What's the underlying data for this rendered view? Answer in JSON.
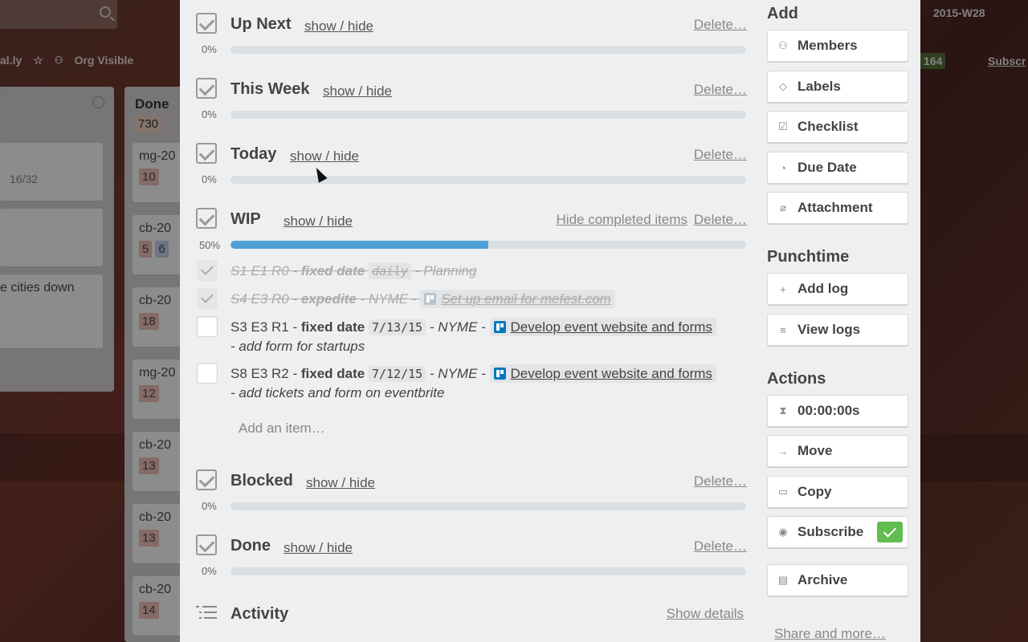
{
  "background": {
    "board_header": [
      "al.ly",
      "Org Visible"
    ],
    "done_list": {
      "title": "Done",
      "count": "730"
    },
    "left_card_badge": "16/32",
    "left_card_text": "e cities down",
    "done_cards": [
      {
        "name": "mg-20",
        "badge": "10"
      },
      {
        "name": "cb-20",
        "badge": "5",
        "badge2": "6"
      },
      {
        "name": "cb-20",
        "badge": "18"
      },
      {
        "name": "mg-20",
        "badge": "12"
      },
      {
        "name": "cb-20",
        "badge": "13"
      },
      {
        "name": "cb-20",
        "badge": "13"
      },
      {
        "name": "cb-20",
        "badge": "14"
      }
    ],
    "right_header": {
      "week": "2015-W28",
      "count": "164",
      "subscribe": "Subscr"
    }
  },
  "checklists": [
    {
      "title": "Up Next",
      "toggle": "show / hide",
      "delete": "Delete…",
      "percent": "0%",
      "progress": 0
    },
    {
      "title": "This Week",
      "toggle": "show / hide",
      "delete": "Delete…",
      "percent": "0%",
      "progress": 0
    },
    {
      "title": "Today",
      "toggle": "show / hide",
      "delete": "Delete…",
      "percent": "0%",
      "progress": 0
    },
    {
      "title": "WIP",
      "toggle": "show / hide",
      "hide_completed": "Hide completed items",
      "delete": "Delete…",
      "percent": "50%",
      "progress": 0.5
    },
    {
      "title": "Blocked",
      "toggle": "show / hide",
      "delete": "Delete…",
      "percent": "0%",
      "progress": 0
    },
    {
      "title": "Done",
      "toggle": "show / hide",
      "delete": "Delete…",
      "percent": "0%",
      "progress": 0
    }
  ],
  "wip_items": [
    {
      "done": true,
      "id": "S1 E1 R0",
      "sep1": " - ",
      "kind": "fixed date",
      "code": "daily",
      "rest": " - Planning"
    },
    {
      "done": true,
      "id": "S4 E3 R0",
      "sep1": " - ",
      "kind": "expedite",
      "rest": " - NYME - ",
      "link": "Set up email for mefest.com"
    },
    {
      "done": false,
      "id": "S3 E3 R1",
      "sep1": " - ",
      "kind": "fixed date",
      "code": "7/13/15",
      "rest": " - NYME - ",
      "link": "Develop event website and forms",
      "tail": "- add form for startups"
    },
    {
      "done": false,
      "id": "S8 E3 R2",
      "sep1": " - ",
      "kind": "fixed date",
      "code": "7/12/15",
      "rest": " - NYME - ",
      "link": "Develop event website and forms",
      "tail": "- add tickets and form on eventbrite"
    }
  ],
  "add_item": "Add an item…",
  "activity": {
    "title": "Activity",
    "show_details": "Show details"
  },
  "sidebar": {
    "add_heading": "Add",
    "add_buttons": [
      {
        "label": "Members",
        "icon": "person-icon"
      },
      {
        "label": "Labels",
        "icon": "tag-icon"
      },
      {
        "label": "Checklist",
        "icon": "checkbox-icon"
      },
      {
        "label": "Due Date",
        "icon": "clock-icon"
      },
      {
        "label": "Attachment",
        "icon": "paperclip-icon"
      }
    ],
    "punchtime_heading": "Punchtime",
    "punchtime_buttons": [
      {
        "label": "Add log",
        "icon": "plus-icon"
      },
      {
        "label": "View logs",
        "icon": "list-icon"
      }
    ],
    "actions_heading": "Actions",
    "action_buttons": [
      {
        "label": "00:00:00s",
        "icon": "hourglass-icon"
      },
      {
        "label": "Move",
        "icon": "arrow-right-icon"
      },
      {
        "label": "Copy",
        "icon": "copy-icon"
      },
      {
        "label": "Subscribe",
        "icon": "eye-icon",
        "checked": true
      },
      {
        "label": "Archive",
        "icon": "archive-icon"
      }
    ],
    "share_more": "Share and more…"
  },
  "colors": {
    "progress_fill": "#4fa0d6",
    "subscribed_badge": "#61bd4f",
    "modal_bg": "#edeff0"
  }
}
